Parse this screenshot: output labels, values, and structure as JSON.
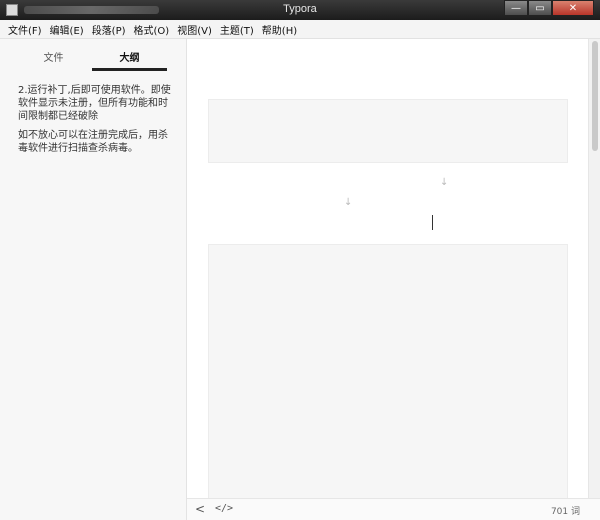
{
  "window": {
    "title": "Typora",
    "controls": {
      "minimize": "—",
      "maximize": "▭",
      "close": "✕"
    }
  },
  "menu": [
    "文件(F)",
    "编辑(E)",
    "段落(P)",
    "格式(O)",
    "视图(V)",
    "主题(T)",
    "帮助(H)"
  ],
  "sidebar": {
    "tabs": {
      "files": "文件",
      "outline": "大纲"
    },
    "paragraphs": [
      "2.运行补丁,后即可使用软件。即使软件显示未注册，但所有功能和时间限制都已经破除",
      "如不放心可以在注册完成后，用杀毒软件进行扫描查杀病毒。"
    ]
  },
  "footer": {
    "back": "<",
    "source_toggle": "</>",
    "word_count": "701 词"
  },
  "icons": {
    "app": "app-icon",
    "back": "chevron-left-icon",
    "source": "code-icon"
  }
}
